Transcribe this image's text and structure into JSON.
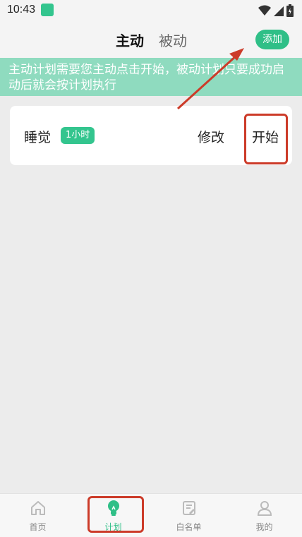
{
  "status_bar": {
    "time": "10:43"
  },
  "header": {
    "tab_active": "主动",
    "tab_inactive": "被动",
    "add_button": "添加"
  },
  "banner": {
    "text": "主动计划需要您主动点击开始，被动计划只要成功启动后就会按计划执行"
  },
  "plans": [
    {
      "title": "睡觉",
      "duration": "1小时",
      "edit_label": "修改",
      "start_label": "开始"
    }
  ],
  "bottom_nav": {
    "items": [
      {
        "label": "首页",
        "icon": "home-icon",
        "active": false
      },
      {
        "label": "计划",
        "icon": "lightbulb-icon",
        "active": true
      },
      {
        "label": "白名单",
        "icon": "whitelist-icon",
        "active": false
      },
      {
        "label": "我的",
        "icon": "user-icon",
        "active": false
      }
    ]
  },
  "colors": {
    "accent": "#2fbf87",
    "banner": "#8fdbbf",
    "annotation": "#cc3b29"
  }
}
